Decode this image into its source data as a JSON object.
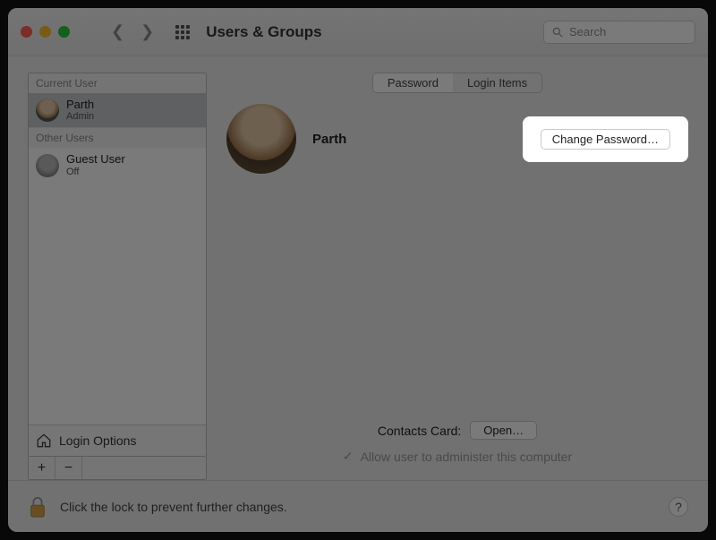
{
  "window": {
    "title": "Users & Groups"
  },
  "search": {
    "placeholder": "Search"
  },
  "sidebar": {
    "section_current": "Current User",
    "section_other": "Other Users",
    "users": [
      {
        "name": "Parth",
        "role": "Admin"
      },
      {
        "name": "Guest User",
        "role": "Off"
      }
    ],
    "login_options": "Login Options",
    "add": "+",
    "remove": "−"
  },
  "tabs": {
    "password": "Password",
    "login_items": "Login Items"
  },
  "user": {
    "name": "Parth"
  },
  "buttons": {
    "change_password": "Change Password…",
    "open": "Open…"
  },
  "contacts_label": "Contacts Card:",
  "admin_checkbox": "Allow user to administer this computer",
  "footer": {
    "text": "Click the lock to prevent further changes."
  },
  "help": "?"
}
